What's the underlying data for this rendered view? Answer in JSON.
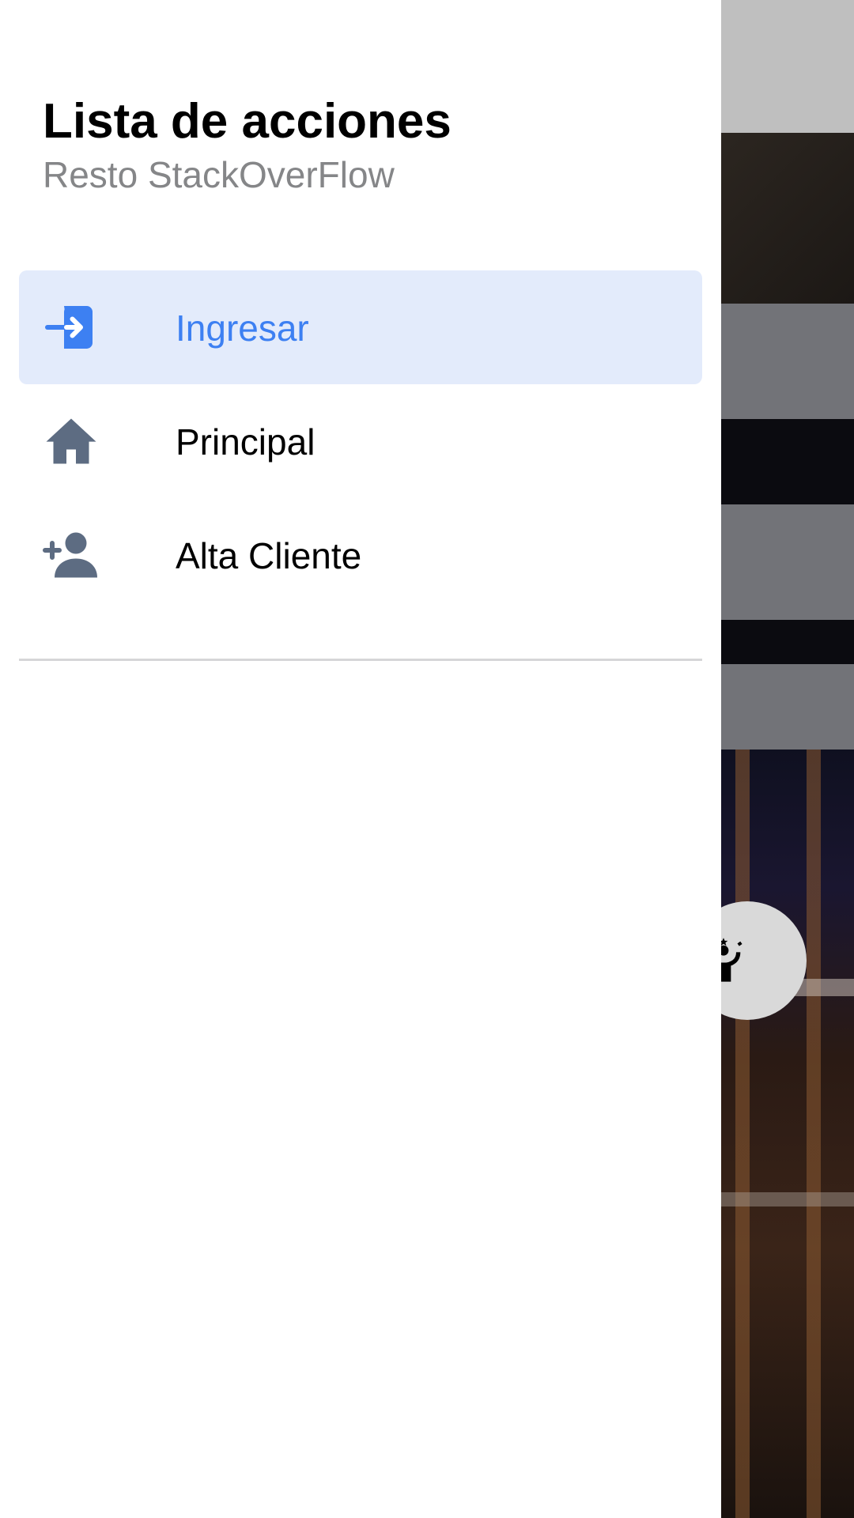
{
  "drawer": {
    "title": "Lista de acciones",
    "subtitle": "Resto StackOverFlow",
    "items": [
      {
        "label": "Ingresar",
        "icon": "log-in-icon",
        "active": true
      },
      {
        "label": "Principal",
        "icon": "home-icon",
        "active": false
      },
      {
        "label": "Alta Cliente",
        "icon": "person-add-icon",
        "active": false
      }
    ]
  },
  "fab": {
    "icon": "accessibility-icon"
  },
  "colors": {
    "active_background": "#e3ebfb",
    "active_text": "#3d80f2",
    "icon_inactive": "#5d6c82",
    "subtitle_text": "#858688"
  }
}
